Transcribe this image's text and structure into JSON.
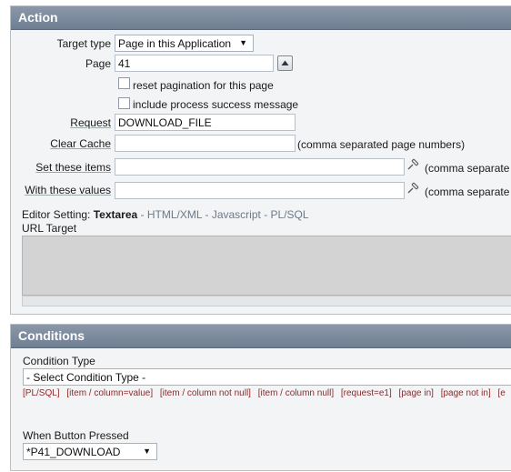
{
  "action": {
    "title": "Action",
    "target_type_label": "Target type",
    "target_type_value": "Page in this Application",
    "page_label": "Page",
    "page_value": "41",
    "reset_pagination_label": "reset pagination for this page",
    "include_success_label": "include process success message",
    "request_label": "Request",
    "request_value": "DOWNLOAD_FILE",
    "clear_cache_label": "Clear Cache",
    "clear_cache_hint": "(comma separated page numbers)",
    "set_items_label": "Set these items",
    "set_items_hint": "(comma separate",
    "with_values_label": "With these values",
    "with_values_hint": "(comma separate",
    "editor_setting_prefix": "Editor Setting:",
    "editor_current": "Textarea",
    "editor_options": [
      "HTML/XML",
      "Javascript",
      "PL/SQL"
    ],
    "editor_sep": "-",
    "url_target_label": "URL Target"
  },
  "conditions": {
    "title": "Conditions",
    "condition_type_label": "Condition Type",
    "condition_type_value": "- Select Condition Type -",
    "shortcuts": [
      "[PL/SQL]",
      "[item / column=value]",
      "[item / column not null]",
      "[item / column null]",
      "[request=e1]",
      "[page in]",
      "[page not in]",
      "[e"
    ],
    "button_pressed_label": "When Button Pressed",
    "button_pressed_value": "*P41_DOWNLOAD"
  },
  "icons": {
    "page_up": "arrow-up-icon",
    "pin": "pin-icon"
  },
  "colors": {
    "header": "#7a8a9c",
    "panel_bg": "#f2f4f6",
    "textarea_bg": "#d3d3d3",
    "condition_link": "#8b2b2b"
  }
}
